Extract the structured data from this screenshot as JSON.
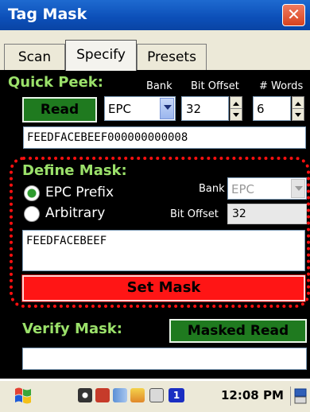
{
  "window": {
    "title": "Tag Mask",
    "close_glyph": "✕"
  },
  "tabs": [
    {
      "label": "Scan"
    },
    {
      "label": "Specify"
    },
    {
      "label": "Presets"
    }
  ],
  "quick_peek": {
    "heading": "Quick Peek:",
    "bank_label": "Bank",
    "bit_offset_label": "Bit Offset",
    "words_label": "# Words",
    "read_button": "Read",
    "bank_value": "EPC",
    "bit_offset_value": "32",
    "words_value": "6",
    "result": "FEEDFACEBEEF000000000008"
  },
  "define_mask": {
    "heading": "Define Mask:",
    "option_epc_prefix": "EPC Prefix",
    "option_arbitrary": "Arbitrary",
    "selected_option": "EPC Prefix",
    "bank_label": "Bank",
    "bank_value": "EPC",
    "bit_offset_label": "Bit Offset",
    "bit_offset_value": "32",
    "mask_value": "FEEDFACEBEEF",
    "set_mask_button": "Set Mask"
  },
  "verify_mask": {
    "heading": "Verify Mask:",
    "masked_read_button": "Masked Read",
    "result": ""
  },
  "taskbar": {
    "clock": "12:08 PM",
    "icons": [
      "start-flag-icon",
      "network-icon",
      "star-icon",
      "connection-icon",
      "power-icon",
      "keyboard-icon",
      "info-badge-icon",
      "input-panel-icon"
    ]
  },
  "colors": {
    "title_bar": "#0c4fb8",
    "panel_bg": "#000000",
    "label_green": "#9be16a",
    "button_green": "#1f7a1f",
    "set_mask_red": "#ff1515",
    "frame_dotted_red": "#ff1010"
  }
}
